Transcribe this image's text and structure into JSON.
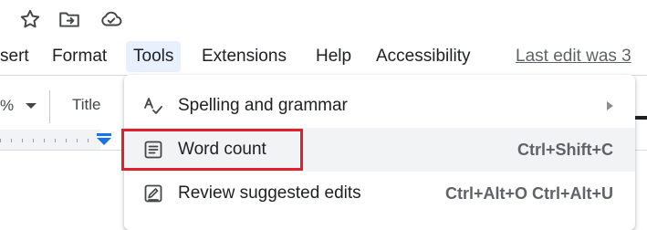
{
  "title_icons": [
    "star-icon",
    "move-to-folder-icon",
    "cloud-saved-icon"
  ],
  "menubar": {
    "items": [
      {
        "label": "sert"
      },
      {
        "label": "Format"
      },
      {
        "label": "Tools"
      },
      {
        "label": "Extensions"
      },
      {
        "label": "Help"
      },
      {
        "label": "Accessibility"
      }
    ],
    "last_edit": "Last edit was 3"
  },
  "toolbar": {
    "zoom_fragment": "%",
    "style_label": "Title"
  },
  "dropdown": {
    "items": [
      {
        "label": "Spelling and grammar",
        "shortcut": "",
        "icon": "spelling-grammar-icon",
        "has_submenu": true
      },
      {
        "label": "Word count",
        "shortcut": "Ctrl+Shift+C",
        "icon": "word-count-icon",
        "has_submenu": false
      },
      {
        "label": "Review suggested edits",
        "shortcut": "Ctrl+Alt+O Ctrl+Alt+U",
        "icon": "review-edits-icon",
        "has_submenu": false
      }
    ]
  },
  "colors": {
    "active_menu_bg": "#e8f0fe",
    "highlight_box": "#e0202a",
    "ruler_marker": "#1a73e8"
  }
}
